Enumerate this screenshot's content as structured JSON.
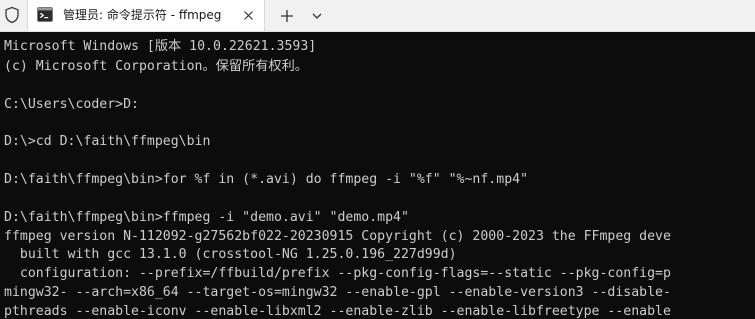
{
  "tab": {
    "title": "管理员: 命令提示符 - ffmpeg"
  },
  "icons": {
    "shield": "shield-icon",
    "terminal": "terminal-icon",
    "close": "close-icon",
    "new_tab": "plus-icon",
    "dropdown": "chevron-down-icon"
  },
  "colors": {
    "console_bg": "#0c0c0c",
    "console_text": "#cccccc",
    "tabbar_bg": "#f1f1f1",
    "tab_active_bg": "#ffffff"
  },
  "console": {
    "line1_a": "Microsoft Windows [",
    "line1_b": "版本",
    "line1_c": " 10.0.22621.3593]",
    "line2_a": "(c) Microsoft Corporation",
    "line2_b": "。保留所有权利。",
    "line3": "C:\\Users\\coder>D:",
    "line4": "D:\\>cd D:\\faith\\ffmpeg\\bin",
    "line5": "D:\\faith\\ffmpeg\\bin>for %f in (*.avi) do ffmpeg -i \"%f\" \"%~nf.mp4\"",
    "line6": "D:\\faith\\ffmpeg\\bin>ffmpeg -i \"demo.avi\" \"demo.mp4\"",
    "line7": "ffmpeg version N-112092-g27562bf022-20230915 Copyright (c) 2000-2023 the FFmpeg deve",
    "line8": "  built with gcc 13.1.0 (crosstool-NG 1.25.0.196_227d99d)",
    "line9": "  configuration: --prefix=/ffbuild/prefix --pkg-config-flags=--static --pkg-config=p",
    "line10": "mingw32- --arch=x86_64 --target-os=mingw32 --enable-gpl --enable-version3 --disable-",
    "line11": "pthreads --enable-iconv --enable-libxml2 --enable-zlib --enable-libfreetype --enable"
  }
}
